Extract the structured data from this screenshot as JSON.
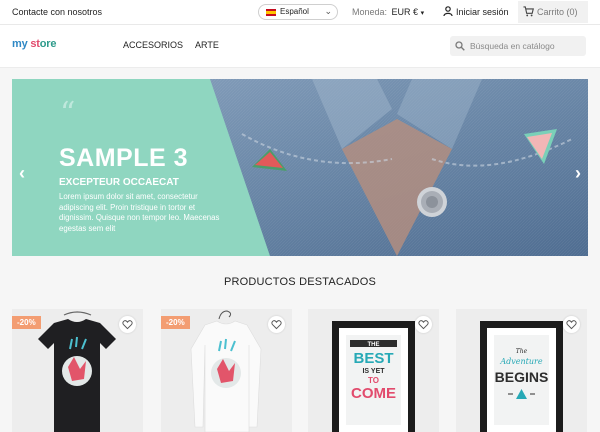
{
  "topbar": {
    "contact": "Contacte con nosotros",
    "language": "Español",
    "currency_label": "Moneda:",
    "currency_value": "EUR €",
    "login": "Iniciar sesión",
    "cart": "Carrito (0)"
  },
  "header": {
    "logo_part1": "my",
    "logo_part2": "st",
    "logo_part3": "ore",
    "nav": [
      "ACCESORIOS",
      "ARTE"
    ],
    "search_placeholder": "Búsqueda en catálogo"
  },
  "slider": {
    "title": "SAMPLE 3",
    "subtitle": "EXCEPTEUR OCCAECAT",
    "description": "Lorem ipsum dolor sit amet, consectetur adipiscing elit. Proin tristique in tortor et dignissim. Quisque non tempor leo. Maecenas egestas sem elit"
  },
  "featured_title": "PRODUCTOS DESTACADOS",
  "products": [
    {
      "discount": "-20%"
    },
    {
      "discount": "-20%"
    },
    {
      "poster_lines": [
        "THE",
        "BEST",
        "IS YET",
        "TO",
        "COME"
      ]
    },
    {
      "poster_lines": [
        "The",
        "Adventure",
        "BEGINS"
      ]
    }
  ],
  "colors": {
    "accent": "#24b9d7",
    "mint": "#8fd6c0",
    "discount": "#f39d72"
  },
  "icons": [
    "flag-icon",
    "chevron-down-icon",
    "person-icon",
    "cart-icon",
    "search-icon",
    "heart-icon",
    "arrow-left-icon",
    "arrow-right-icon"
  ]
}
